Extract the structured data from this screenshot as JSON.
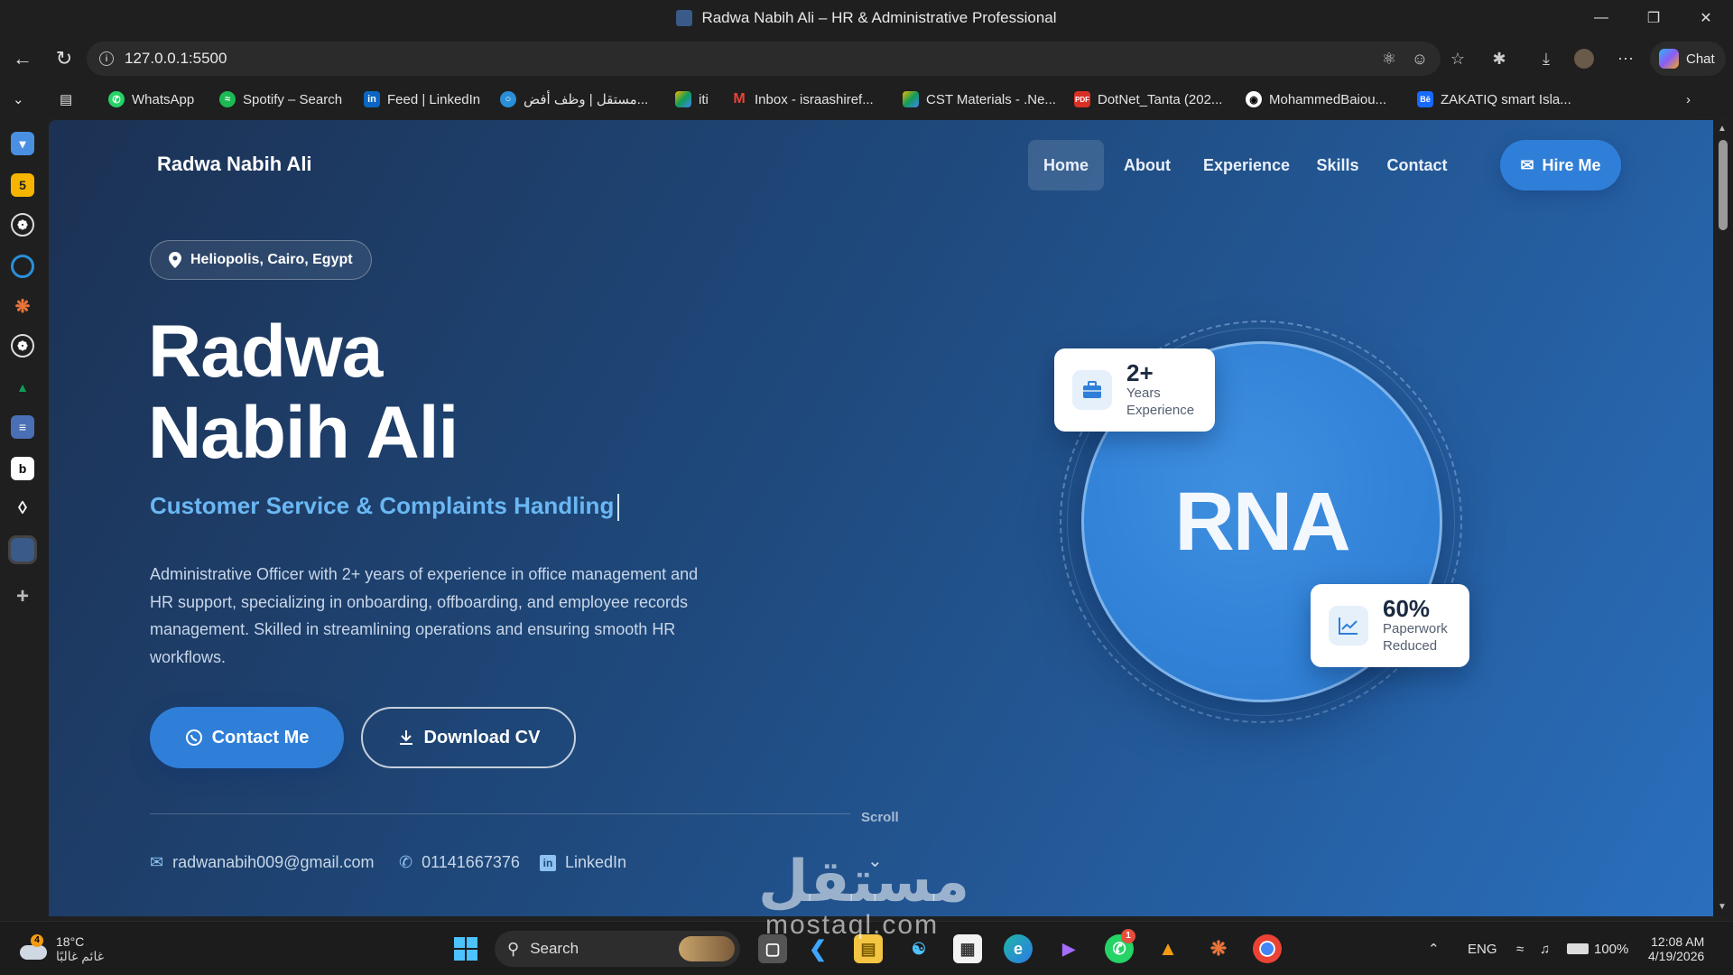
{
  "window": {
    "title": "Radwa Nabih Ali – HR & Administrative Professional"
  },
  "address_bar": {
    "url": "127.0.0.1:5500"
  },
  "chat_button": {
    "label": "Chat"
  },
  "bookmarks": [
    {
      "label": "WhatsApp",
      "icon": "whatsapp-icon",
      "color": "#25d366"
    },
    {
      "label": "Spotify – Search",
      "icon": "spotify-icon",
      "color": "#1db954"
    },
    {
      "label": "Feed | LinkedIn",
      "icon": "linkedin-icon",
      "color": "#0a66c2"
    },
    {
      "label": "مستقل | وظف أفض...",
      "icon": "mostaql-icon",
      "color": "#2a8fd8"
    },
    {
      "label": "iti",
      "icon": "drive-icon",
      "color": "#f4b400"
    },
    {
      "label": "Inbox - israashiref...",
      "icon": "gmail-icon",
      "color": "#ea4335"
    },
    {
      "label": "CST Materials - .Ne...",
      "icon": "drive-icon",
      "color": "#0f9d58"
    },
    {
      "label": "DotNet_Tanta (202...",
      "icon": "pdf-icon",
      "color": "#d93025"
    },
    {
      "label": "MohammedBaiou...",
      "icon": "github-icon",
      "color": "#ffffff"
    },
    {
      "label": "ZAKATIQ smart Isla...",
      "icon": "behance-icon",
      "color": "#1769ff"
    }
  ],
  "page": {
    "brand": "Radwa Nabih Ali",
    "nav": [
      "Home",
      "About",
      "Experience",
      "Skills",
      "Contact"
    ],
    "active_nav": "Home",
    "hire_button": "Hire Me",
    "location": "Heliopolis, Cairo, Egypt",
    "name_line1": "Radwa",
    "name_line2": "Nabih Ali",
    "role": "Customer Service & Complaints Handling",
    "bio": "Administrative Officer with 2+ years of experience in office management and HR support, specializing in onboarding, offboarding, and employee records management. Skilled in streamlining operations and ensuring smooth HR workflows.",
    "contact_button": "Contact Me",
    "cv_button": "Download CV",
    "scroll_label": "Scroll",
    "contacts": {
      "email": "radwanabih009@gmail.com",
      "phone": "01141667376",
      "linkedin": "LinkedIn"
    },
    "initials": "RNA",
    "stat_cards": [
      {
        "value": "2+",
        "label_line1": "Years",
        "label_line2": "Experience",
        "icon": "briefcase-icon"
      },
      {
        "value": "60%",
        "label_line1": "Paperwork",
        "label_line2": "Reduced",
        "icon": "chart-trend-icon"
      }
    ],
    "accent_color": "#2f7fd8",
    "role_color": "#6ab7f3"
  },
  "watermark": {
    "arabic": "مستقل",
    "latin": "mostaql.com"
  },
  "taskbar": {
    "weather_temp": "18°C",
    "weather_desc": "غائم غالبًا",
    "weather_badge": "4",
    "search_label": "Search",
    "whatsapp_badge": "1",
    "language": "ENG",
    "battery": "100%",
    "time": "12:08 AM",
    "date": "4/19/2026"
  }
}
